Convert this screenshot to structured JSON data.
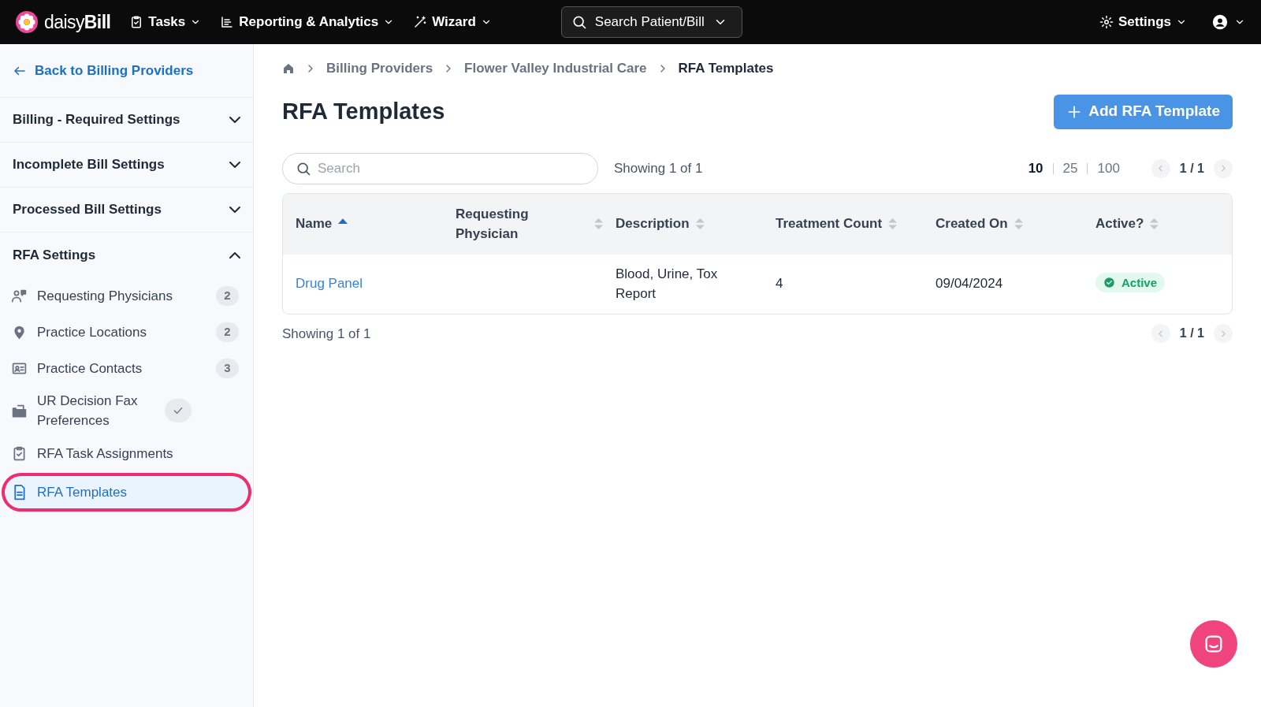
{
  "header": {
    "logo": "daisy**Bill**",
    "menus": [
      {
        "label": "Tasks"
      },
      {
        "label": "Reporting & Analytics"
      },
      {
        "label": "Wizard"
      }
    ],
    "search": {
      "placeholder": "Search Patient/Bill"
    },
    "settings": "Settings"
  },
  "sidebar": {
    "back": "Back to Billing Providers",
    "sections": [
      {
        "label": "Billing - Required Settings",
        "expanded": false
      },
      {
        "label": "Incomplete Bill Settings",
        "expanded": false
      },
      {
        "label": "Processed Bill Settings",
        "expanded": false
      },
      {
        "label": "RFA Settings",
        "expanded": true,
        "items": [
          {
            "label": "Requesting Physicians",
            "kind": "count",
            "badge": "2",
            "selected": false,
            "highlighted": false
          },
          {
            "label": "Practice Locations",
            "kind": "count",
            "badge": "2",
            "selected": false,
            "highlighted": false
          },
          {
            "label": "Practice Contacts",
            "kind": "count",
            "badge": "3",
            "selected": false,
            "highlighted": false
          },
          {
            "label": "UR Decision Fax Preferences",
            "kind": "check",
            "selected": false,
            "highlighted": false
          },
          {
            "label": "RFA Task Assignments",
            "kind": "plain",
            "selected": false,
            "highlighted": false
          },
          {
            "label": "RFA Templates",
            "kind": "plain",
            "selected": true,
            "highlighted": true
          }
        ]
      }
    ]
  },
  "breadcrumbs": [
    "Billing Providers",
    "Flower Valley Industrial Care",
    "RFA Templates"
  ],
  "title": "RFA Templates",
  "add_button": "Add RFA Template",
  "search": {
    "placeholder": "Search"
  },
  "showing_top": "Showing 1 of 1",
  "page_sizes": [
    {
      "label": "10",
      "selected": true
    },
    {
      "label": "25",
      "selected": false
    },
    {
      "label": "100",
      "selected": false
    }
  ],
  "pager_top": "1 / 1",
  "table": {
    "columns": [
      {
        "label": "Name",
        "sorted": true
      },
      {
        "label": "Requesting Physician",
        "sorted": false
      },
      {
        "label": "Description",
        "sorted": false
      },
      {
        "label": "Treatment Count",
        "sorted": false
      },
      {
        "label": "Created On",
        "sorted": false
      },
      {
        "label": "Active?",
        "sorted": false
      }
    ],
    "rows": [
      {
        "name": "Drug Panel",
        "description": "Blood, Urine, Tox Report",
        "count": "4",
        "created": "09/04/2024",
        "status": {
          "label": "Active",
          "active": true
        }
      }
    ]
  },
  "showing_bottom": "Showing 1 of 1",
  "pager_bottom": "1 / 1"
}
